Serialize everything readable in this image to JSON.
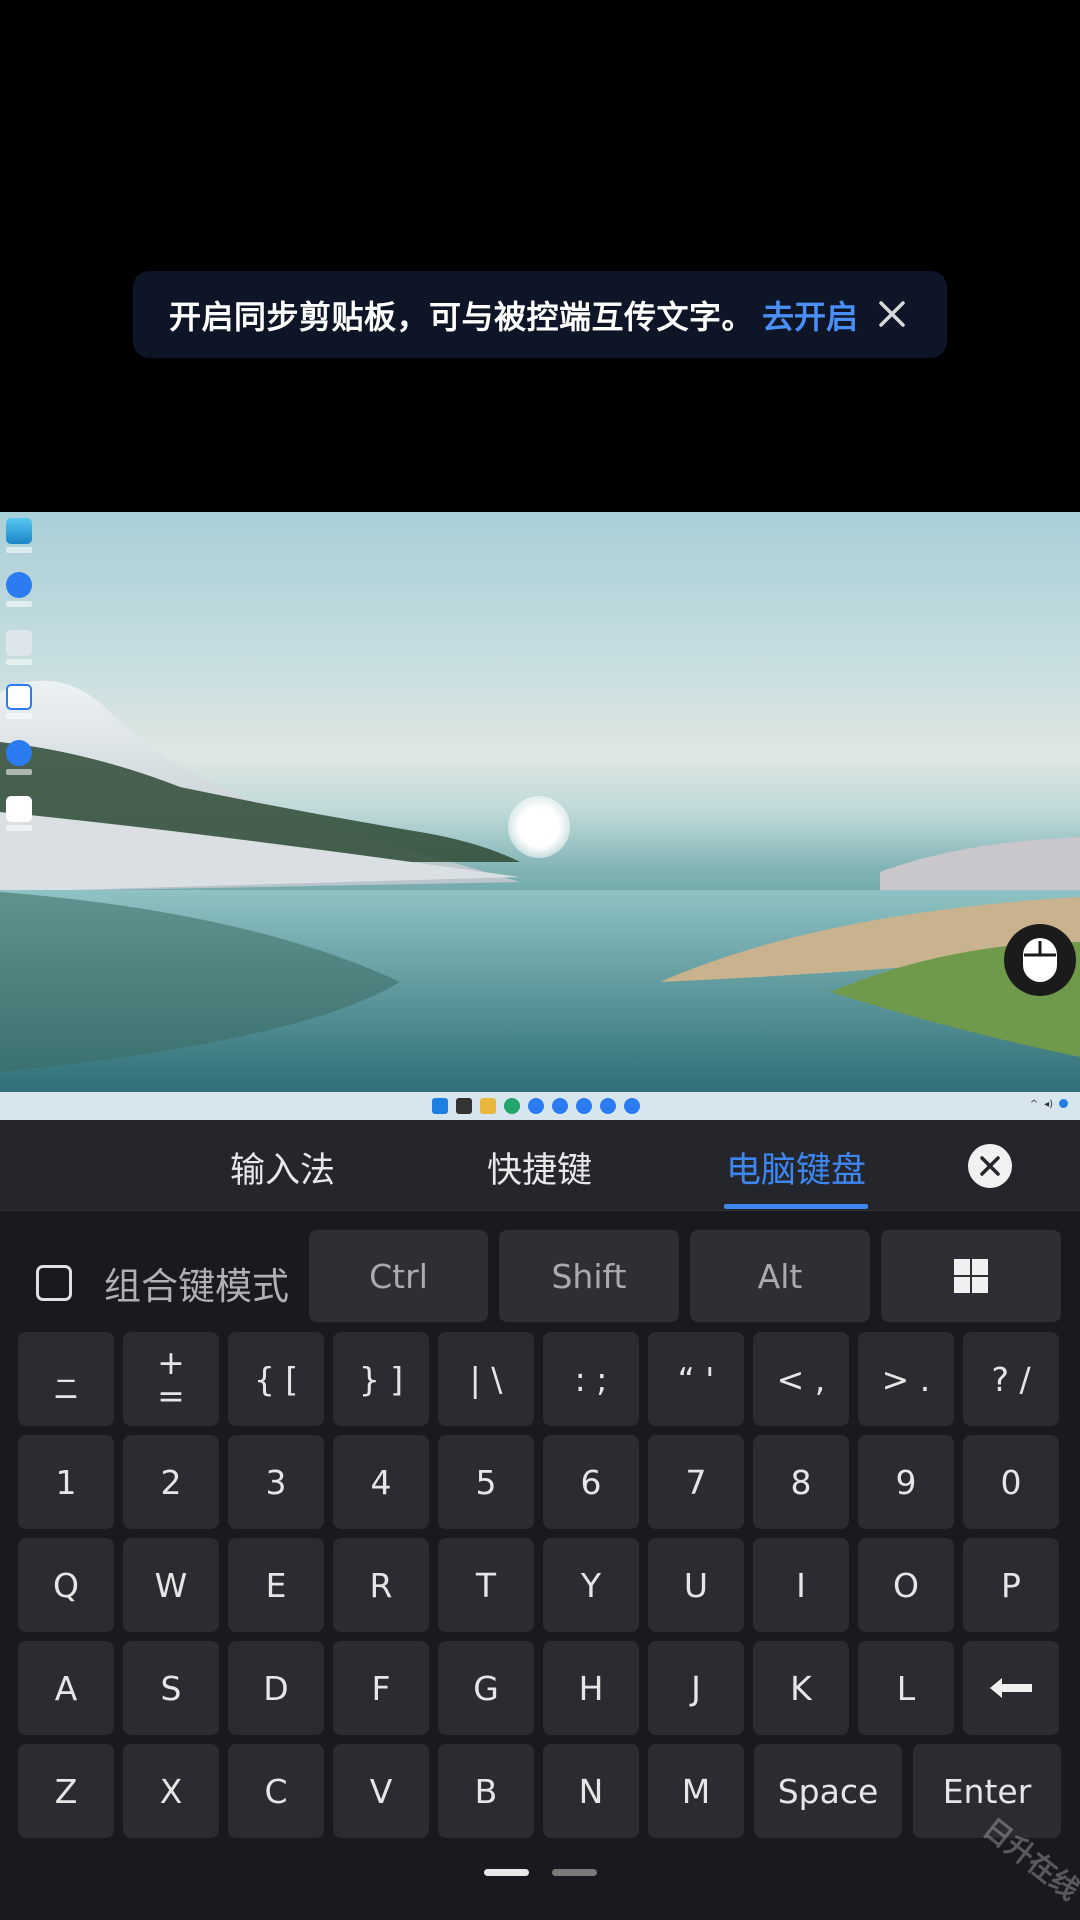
{
  "toast": {
    "message": "开启同步剪贴板，可与被控端互传文字。",
    "action": "去开启"
  },
  "keyboard_panel": {
    "tabs": [
      "输入法",
      "快捷键",
      "电脑键盘"
    ],
    "active_tab": "电脑键盘",
    "combo_mode_label": "组合键模式",
    "modifiers": [
      "Ctrl",
      "Shift",
      "Alt"
    ],
    "symbol_row": [
      "_\n−",
      "+\n=",
      "{ [",
      "} ]",
      "| \\",
      ": ;",
      "“ '",
      "< ,",
      "> .",
      "? /"
    ],
    "number_row": [
      "1",
      "2",
      "3",
      "4",
      "5",
      "6",
      "7",
      "8",
      "9",
      "0"
    ],
    "row_q": [
      "Q",
      "W",
      "E",
      "R",
      "T",
      "Y",
      "U",
      "I",
      "O",
      "P"
    ],
    "row_a": [
      "A",
      "S",
      "D",
      "F",
      "G",
      "H",
      "J",
      "K",
      "L"
    ],
    "row_z": [
      "Z",
      "X",
      "C",
      "V",
      "B",
      "N",
      "M"
    ],
    "space_label": "Space",
    "enter_label": "Enter"
  },
  "watermark": "日升在线",
  "colors": {
    "accent": "#3e86f2",
    "panel_bg": "#181a1f",
    "key_bg": "#2a2c31",
    "toast_bg": "#0d1526"
  },
  "icons": {
    "toast_close": "close-icon",
    "panel_close": "circle-close-icon",
    "windows_key": "windows-logo-icon",
    "backspace": "backspace-arrow-icon",
    "mouse": "mouse-icon"
  }
}
